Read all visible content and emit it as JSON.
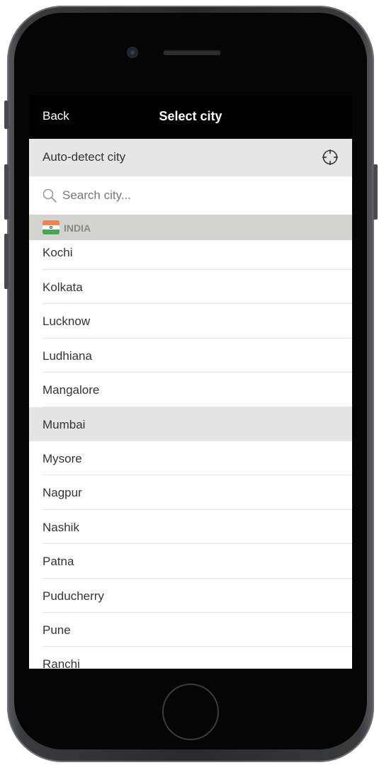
{
  "nav": {
    "back_label": "Back",
    "title": "Select city"
  },
  "auto_detect": {
    "label": "Auto-detect city",
    "icon": "crosshair-target-icon"
  },
  "search": {
    "placeholder": "Search city...",
    "value": "",
    "icon": "search-icon"
  },
  "section": {
    "label": "INDIA",
    "icon": "india-flag-icon"
  },
  "cities": [
    {
      "name": "Kochi",
      "selected": false
    },
    {
      "name": "Kolkata",
      "selected": false
    },
    {
      "name": "Lucknow",
      "selected": false
    },
    {
      "name": "Ludhiana",
      "selected": false
    },
    {
      "name": "Mangalore",
      "selected": false
    },
    {
      "name": "Mumbai",
      "selected": true
    },
    {
      "name": "Mysore",
      "selected": false
    },
    {
      "name": "Nagpur",
      "selected": false
    },
    {
      "name": "Nashik",
      "selected": false
    },
    {
      "name": "Patna",
      "selected": false
    },
    {
      "name": "Puducherry",
      "selected": false
    },
    {
      "name": "Pune",
      "selected": false
    },
    {
      "name": "Ranchi",
      "selected": false
    }
  ],
  "colors": {
    "nav_background": "#000000",
    "auto_detect_background": "#e6e6e6",
    "section_header_background": "#d3d3cf",
    "selected_row_background": "#e5e5e5",
    "text": "#333333"
  }
}
